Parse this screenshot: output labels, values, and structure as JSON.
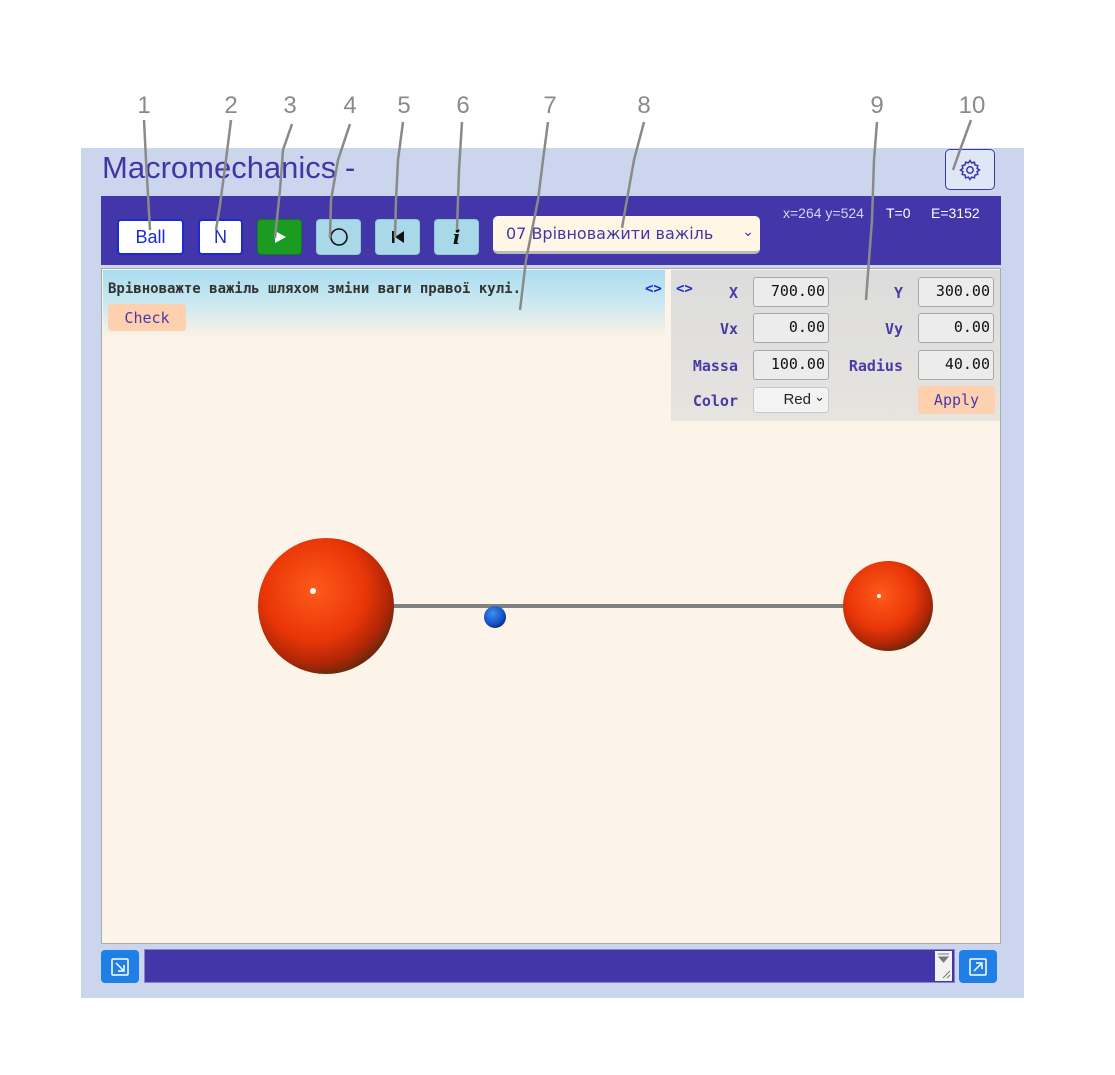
{
  "callouts": [
    "1",
    "2",
    "3",
    "4",
    "5",
    "6",
    "7",
    "8",
    "9",
    "10"
  ],
  "app": {
    "title": "Macromechanics -"
  },
  "toolbar": {
    "ball_label": "Ball",
    "n_label": "N",
    "play_icon": "play-icon",
    "circle_icon": "circle-icon",
    "reset_icon": "skip-back-icon",
    "info_label": "i",
    "scene_selected": "07 Врівноважити важіль",
    "status": {
      "coords": "x=264 y=524",
      "time": "T=0",
      "energy": "E=3152"
    }
  },
  "task": {
    "text": "Врівноважте важіль шляхом зміни ваги правої кулі.",
    "check_label": "Check",
    "toggle": "<>"
  },
  "properties": {
    "toggle": "<>",
    "x_label": "X",
    "x_value": "700.00",
    "y_label": "Y",
    "y_value": "300.00",
    "vx_label": "Vx",
    "vx_value": "0.00",
    "vy_label": "Vy",
    "vy_value": "0.00",
    "mass_label": "Massa",
    "mass_value": "100.00",
    "radius_label": "Radius",
    "radius_value": "40.00",
    "color_label": "Color",
    "color_value": "Red",
    "apply_label": "Apply"
  },
  "colors": {
    "accent": "#4336a8",
    "canvas": "#fdf4e9",
    "ball": "#e83a10",
    "pivot": "#1254c8",
    "button_blue": "#1f7fe6"
  }
}
